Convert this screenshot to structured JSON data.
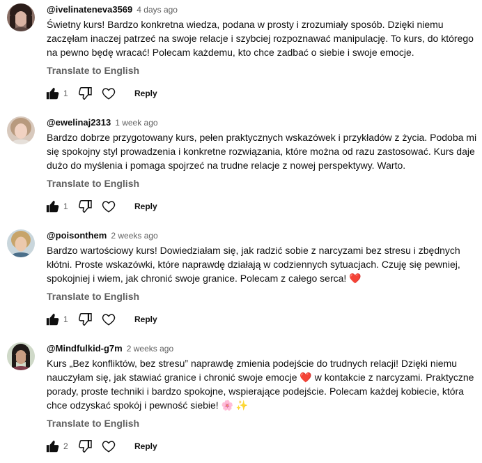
{
  "ui": {
    "translate_label": "Translate to English",
    "reply_label": "Reply"
  },
  "comments": [
    {
      "author": "@ivelinateneva3569",
      "time": "4 days ago",
      "text": "Świetny kurs! Bardzo konkretna wiedza, podana w prosty i zrozumiały sposób. Dzięki niemu zaczęłam inaczej patrzeć na swoje relacje i szybciej rozpoznawać manipulację. To kurs, do którego na pewno będę wracać! Polecam każdemu, kto chce zadbać o siebie i swoje emocje.",
      "likes": "1"
    },
    {
      "author": "@ewelinaj2313",
      "time": "1 week ago",
      "text": "Bardzo dobrze przygotowany kurs, pełen praktycznych wskazówek i przykładów z życia. Podoba mi się spokojny styl prowadzenia i konkretne rozwiązania, które można od razu zastosować. Kurs daje dużo do myślenia i pomaga spojrzeć na trudne relacje z nowej perspektywy. Warto.",
      "likes": "1"
    },
    {
      "author": "@poisonthem",
      "time": "2 weeks ago",
      "text": "Bardzo wartościowy kurs! Dowiedziałam się, jak radzić sobie z narcyzami bez stresu i zbędnych kłótni. Proste wskazówki, które naprawdę działają w codziennych sytuacjach. Czuję się pewniej, spokojniej i wiem, jak chronić swoje granice. Polecam z całego serca! ❤️",
      "likes": "1"
    },
    {
      "author": "@Mindfulkid-g7m",
      "time": "2 weeks ago",
      "text": "Kurs „Bez konfliktów, bez stresu” naprawdę zmienia podejście do trudnych relacji! Dzięki niemu nauczyłam się, jak stawiać granice i chronić swoje emocje ❤️ w kontakcie z narcyzami. Praktyczne porady, proste techniki i bardzo spokojne, wspierające podejście. Polecam każdej kobiecie, która chce odzyskać spokój i pewność siebie! 🌸 ✨",
      "likes": "2"
    }
  ],
  "colors": {
    "text_primary": "#0f0f0f",
    "text_secondary": "#606060",
    "background": "#ffffff"
  }
}
